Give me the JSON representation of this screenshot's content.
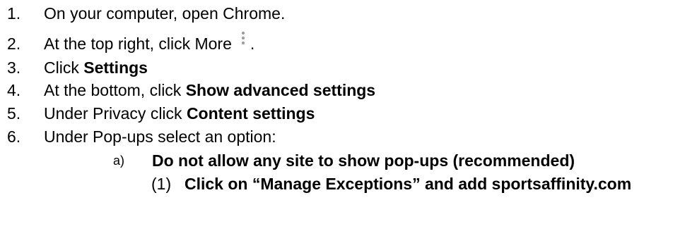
{
  "steps": [
    {
      "num": "1.",
      "text": "On your computer, open Chrome."
    },
    {
      "num": "2.",
      "text_before": "At the top right, click More",
      "text_after": ".",
      "icon": "more-vert-icon"
    },
    {
      "num": "3.",
      "text": "Click ",
      "bold": "Settings"
    },
    {
      "num": "4.",
      "text": "At the bottom, click ",
      "bold": "Show advanced settings"
    },
    {
      "num": "5.",
      "text": "Under Privacy click ",
      "bold": "Content settings"
    },
    {
      "num": "6.",
      "text": "Under Pop-ups select an option:"
    }
  ],
  "substep_a": {
    "label": "a)",
    "bold": "Do not allow any site to show pop-ups (recommended)"
  },
  "substep_1": {
    "label": "(1)",
    "bold": "Click on “Manage Exceptions” and add sportsaffinity.com"
  }
}
